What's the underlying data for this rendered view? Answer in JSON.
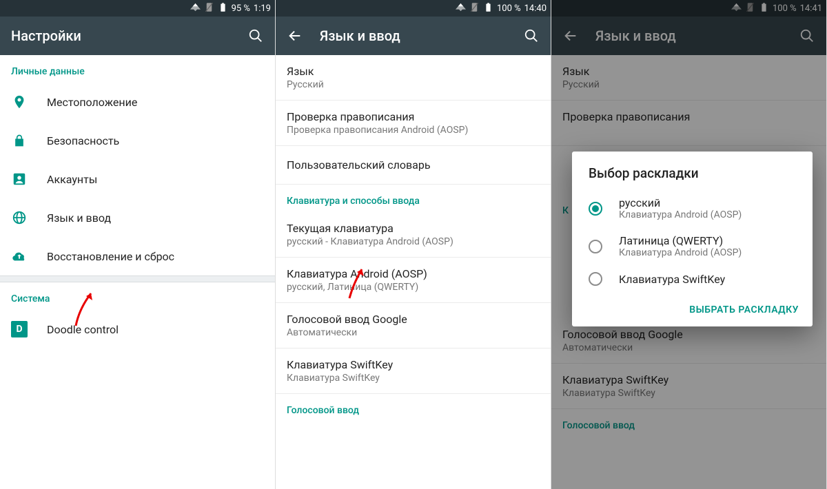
{
  "colors": {
    "accent": "#009688",
    "appbar": "#37474f",
    "statusbar": "#263238"
  },
  "screen1": {
    "status": {
      "battery": "95 %",
      "time": "1:19"
    },
    "title": "Настройки",
    "section_personal": "Личные данные",
    "items": {
      "location": "Местоположение",
      "security": "Безопасность",
      "accounts": "Аккаунты",
      "language": "Язык и ввод",
      "backup": "Восстановление и сброс"
    },
    "section_system": "Система",
    "doodle": "Doodle control"
  },
  "screen2": {
    "status": {
      "battery": "100 %",
      "time": "14:40"
    },
    "title": "Язык и ввод",
    "items": {
      "language": {
        "title": "Язык",
        "sub": "Русский"
      },
      "spell": {
        "title": "Проверка правописания",
        "sub": "Проверка правописания Android (AOSP)"
      },
      "dict": {
        "title": "Пользовательский словарь"
      },
      "section_kb": "Клавиатура и способы ввода",
      "current": {
        "title": "Текущая клавиатура",
        "sub": "русский - Клавиатура Android (AOSP)"
      },
      "aosp": {
        "title": "Клавиатура Android (AOSP)",
        "sub": "русский, Латиница (QWERTY)"
      },
      "google": {
        "title": "Голосовой ввод Google",
        "sub": "Автоматически"
      },
      "swift": {
        "title": "Клавиатура SwiftKey",
        "sub": "Клавиатура SwiftKey"
      },
      "section_voice": "Голосовой ввод"
    }
  },
  "screen3": {
    "status": {
      "battery": "100 %",
      "time": "14:41"
    },
    "title": "Язык и ввод",
    "items": {
      "language": {
        "title": "Язык",
        "sub": "Русский"
      },
      "spell": {
        "title": "Проверка правописания"
      },
      "section_kb_char": "К",
      "google": {
        "title": "Голосовой ввод Google",
        "sub": "Автоматически"
      },
      "swift": {
        "title": "Клавиатура SwiftKey",
        "sub": "Клавиатура SwiftKey"
      },
      "section_voice": "Голосовой ввод"
    },
    "dialog": {
      "title": "Выбор раскладки",
      "options": [
        {
          "title": "русский",
          "sub": "Клавиатура Android (AOSP)",
          "checked": true
        },
        {
          "title": "Латиница (QWERTY)",
          "sub": "Клавиатура Android (AOSP)",
          "checked": false
        },
        {
          "title": "Клавиатура SwiftKey",
          "sub": "",
          "checked": false
        }
      ],
      "action": "ВЫБРАТЬ РАСКЛАДКУ"
    }
  }
}
